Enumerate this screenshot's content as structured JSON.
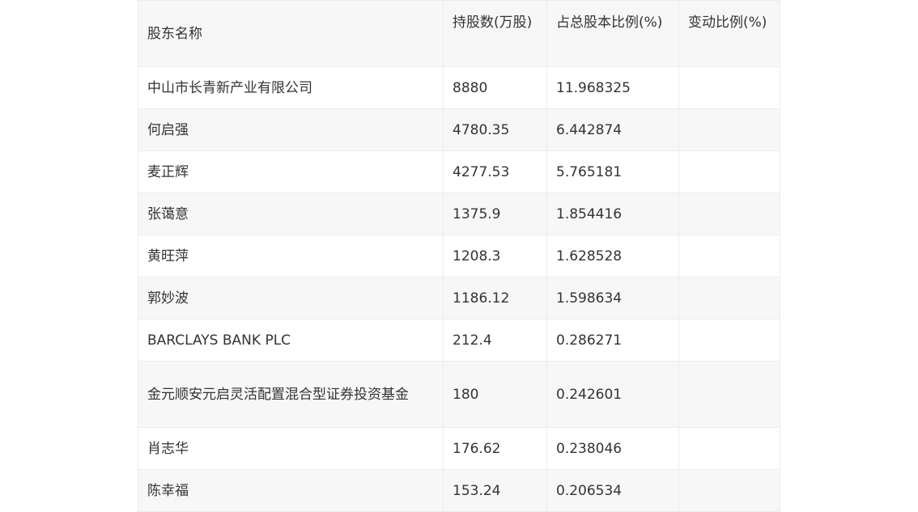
{
  "table": {
    "headers": [
      "股东名称",
      "持股数(万股)",
      "占总股本比例(%)",
      "变动比例(%)"
    ],
    "rows": [
      {
        "name": "中山市长青新产业有限公司",
        "shares": "8880",
        "ratio": "11.968325",
        "change": ""
      },
      {
        "name": "何启强",
        "shares": "4780.35",
        "ratio": "6.442874",
        "change": ""
      },
      {
        "name": "麦正辉",
        "shares": "4277.53",
        "ratio": "5.765181",
        "change": ""
      },
      {
        "name": "张蔼意",
        "shares": "1375.9",
        "ratio": "1.854416",
        "change": ""
      },
      {
        "name": "黄旺萍",
        "shares": "1208.3",
        "ratio": "1.628528",
        "change": ""
      },
      {
        "name": "郭妙波",
        "shares": "1186.12",
        "ratio": "1.598634",
        "change": ""
      },
      {
        "name": "BARCLAYS BANK PLC",
        "shares": "212.4",
        "ratio": "0.286271",
        "change": ""
      },
      {
        "name": "金元顺安元启灵活配置混合型证券投资基金",
        "shares": "180",
        "ratio": "0.242601",
        "change": ""
      },
      {
        "name": "肖志华",
        "shares": "176.62",
        "ratio": "0.238046",
        "change": ""
      },
      {
        "name": "陈幸福",
        "shares": "153.24",
        "ratio": "0.206534",
        "change": ""
      }
    ]
  }
}
